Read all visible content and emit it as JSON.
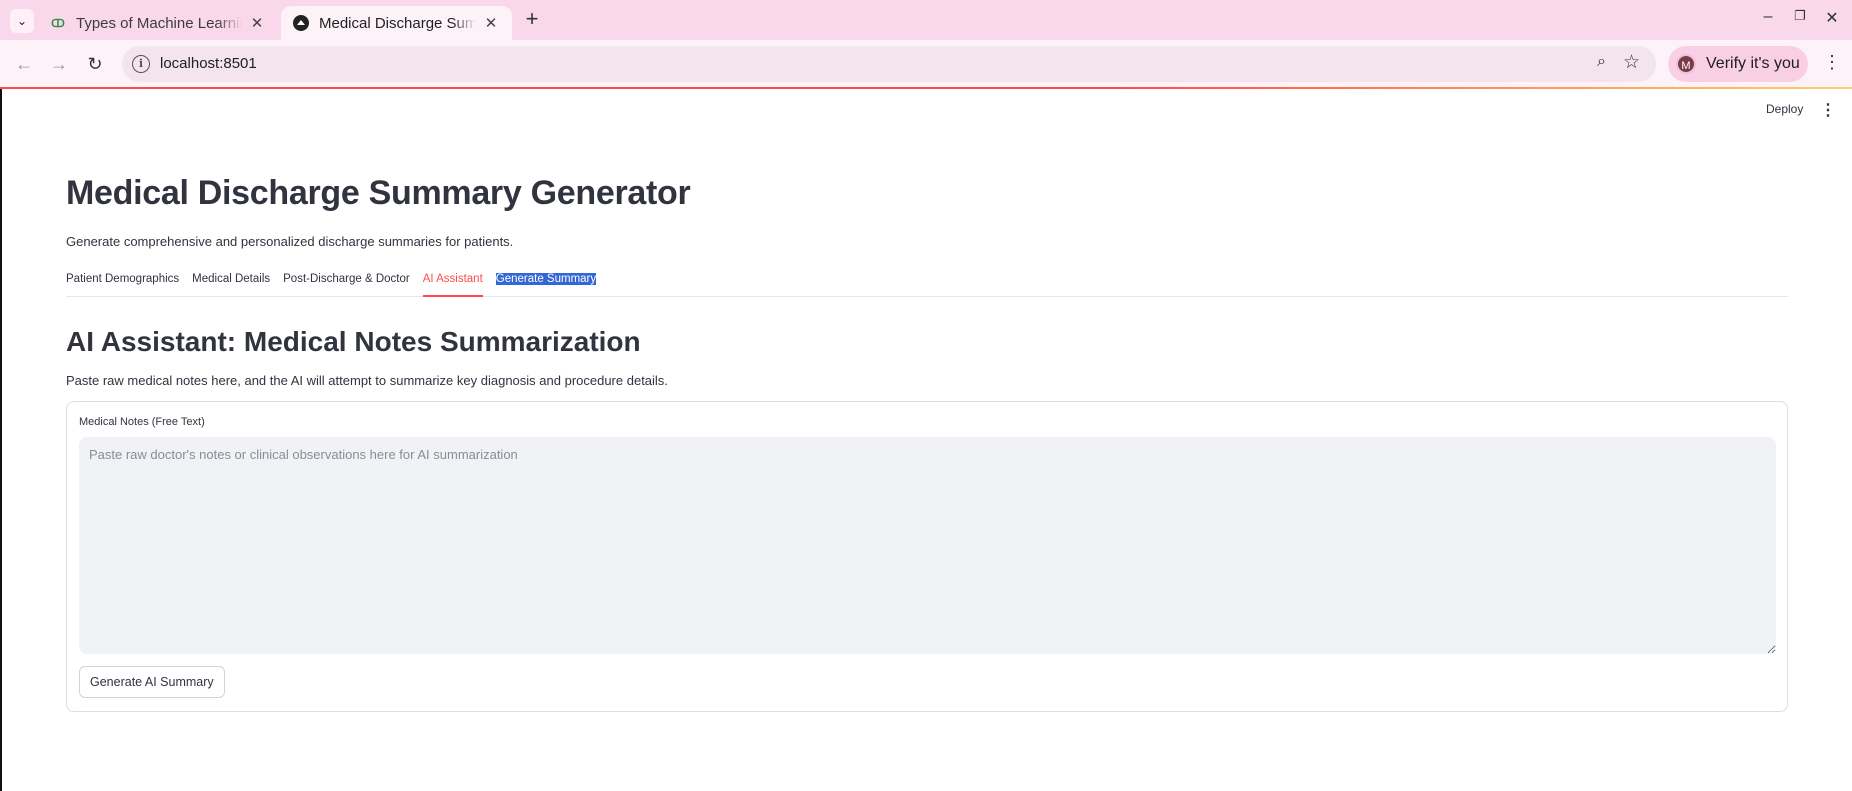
{
  "browser": {
    "tabs": [
      {
        "title": "Types of Machine Learning",
        "favicon": "gfg-icon",
        "active": false
      },
      {
        "title": "Medical Discharge Summary",
        "favicon": "streamlit-icon",
        "active": true
      }
    ],
    "new_tab_symbol": "+",
    "url": "localhost:8501",
    "profile_initial": "M",
    "profile_label": "Verify it's you",
    "window_controls": {
      "minimize": "–",
      "restore": "❐",
      "close": "✕"
    }
  },
  "app_header": {
    "deploy_label": "Deploy"
  },
  "page": {
    "title": "Medical Discharge Summary Generator",
    "subtitle": "Generate comprehensive and personalized discharge summaries for patients.",
    "tabs": [
      {
        "label": "Patient Demographics"
      },
      {
        "label": "Medical Details"
      },
      {
        "label": "Post-Discharge & Doctor"
      },
      {
        "label": "AI Assistant"
      },
      {
        "label": "Generate Summary"
      }
    ],
    "active_tab": "AI Assistant"
  },
  "ai_assistant": {
    "heading": "AI Assistant: Medical Notes Summarization",
    "description": "Paste raw medical notes here, and the AI will attempt to summarize key diagnosis and procedure details.",
    "notes_label": "Medical Notes (Free Text)",
    "notes_value": "",
    "notes_placeholder": "Paste raw doctor's notes or clinical observations here for AI summarization",
    "button_label": "Generate AI Summary"
  },
  "colors": {
    "accent": "#ff4b4b",
    "selection": "#3367d6",
    "tabstrip": "#f9d8ec",
    "text": "#31333f"
  }
}
